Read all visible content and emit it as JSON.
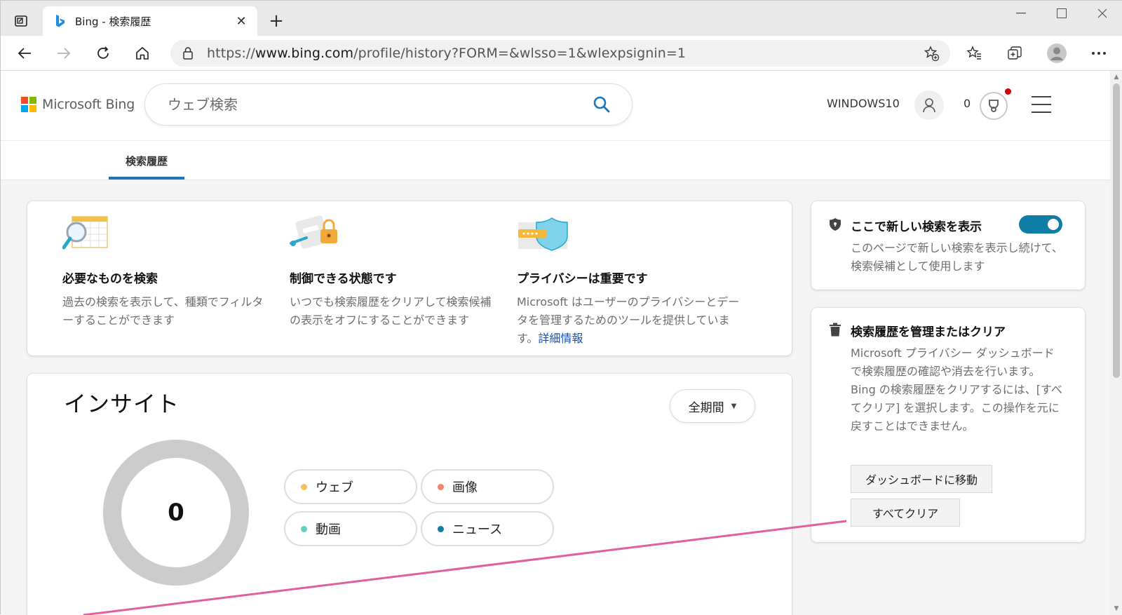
{
  "browser": {
    "tab_title": "Bing - 検索履歴",
    "url_prefix": "https://",
    "url_host": "www.bing.com",
    "url_path": "/profile/history?FORM=&wlsso=1&wlexpsignin=1"
  },
  "header": {
    "brand": "Microsoft Bing",
    "search_placeholder": "ウェブ検索",
    "user_name": "WINDOWS10",
    "reward_count": "0"
  },
  "subnav": {
    "tab_label": "検索履歴"
  },
  "features": [
    {
      "title": "必要なものを検索",
      "text": "過去の検索を表示して、種類でフィルターすることができます"
    },
    {
      "title": "制御できる状態です",
      "text": "いつでも検索履歴をクリアして検索候補の表示をオフにすることができます"
    },
    {
      "title": "プライバシーは重要です",
      "text": "Microsoft はユーザーのプライバシーとデータを管理するためのツールを提供しています。",
      "link": "詳細情報"
    }
  ],
  "insights": {
    "title": "インサイト",
    "period": "全期間",
    "total": "0",
    "categories": [
      {
        "label": "ウェブ",
        "color": "#f5c15b"
      },
      {
        "label": "画像",
        "color": "#f08571"
      },
      {
        "label": "動画",
        "color": "#5fcfc4"
      },
      {
        "label": "ニュース",
        "color": "#137ea3"
      }
    ]
  },
  "side_show": {
    "title": "ここで新しい検索を表示",
    "text": "このページで新しい検索を表示し続けて、検索候補として使用します",
    "toggle_on": true
  },
  "side_manage": {
    "title": "検索履歴を管理またはクリア",
    "text": "Microsoft プライバシー ダッシュボードで検索履歴の確認や消去を行います。Bing の検索履歴をクリアするには、[すべてクリア] を選択します。この操作を元に戻すことはできません。",
    "dashboard_button": "ダッシュボードに移動",
    "clear_button": "すべてクリア"
  },
  "colors": {
    "accent": "#1e74b8",
    "toggle": "#0e7ea7",
    "annotation": "#e0609c"
  }
}
